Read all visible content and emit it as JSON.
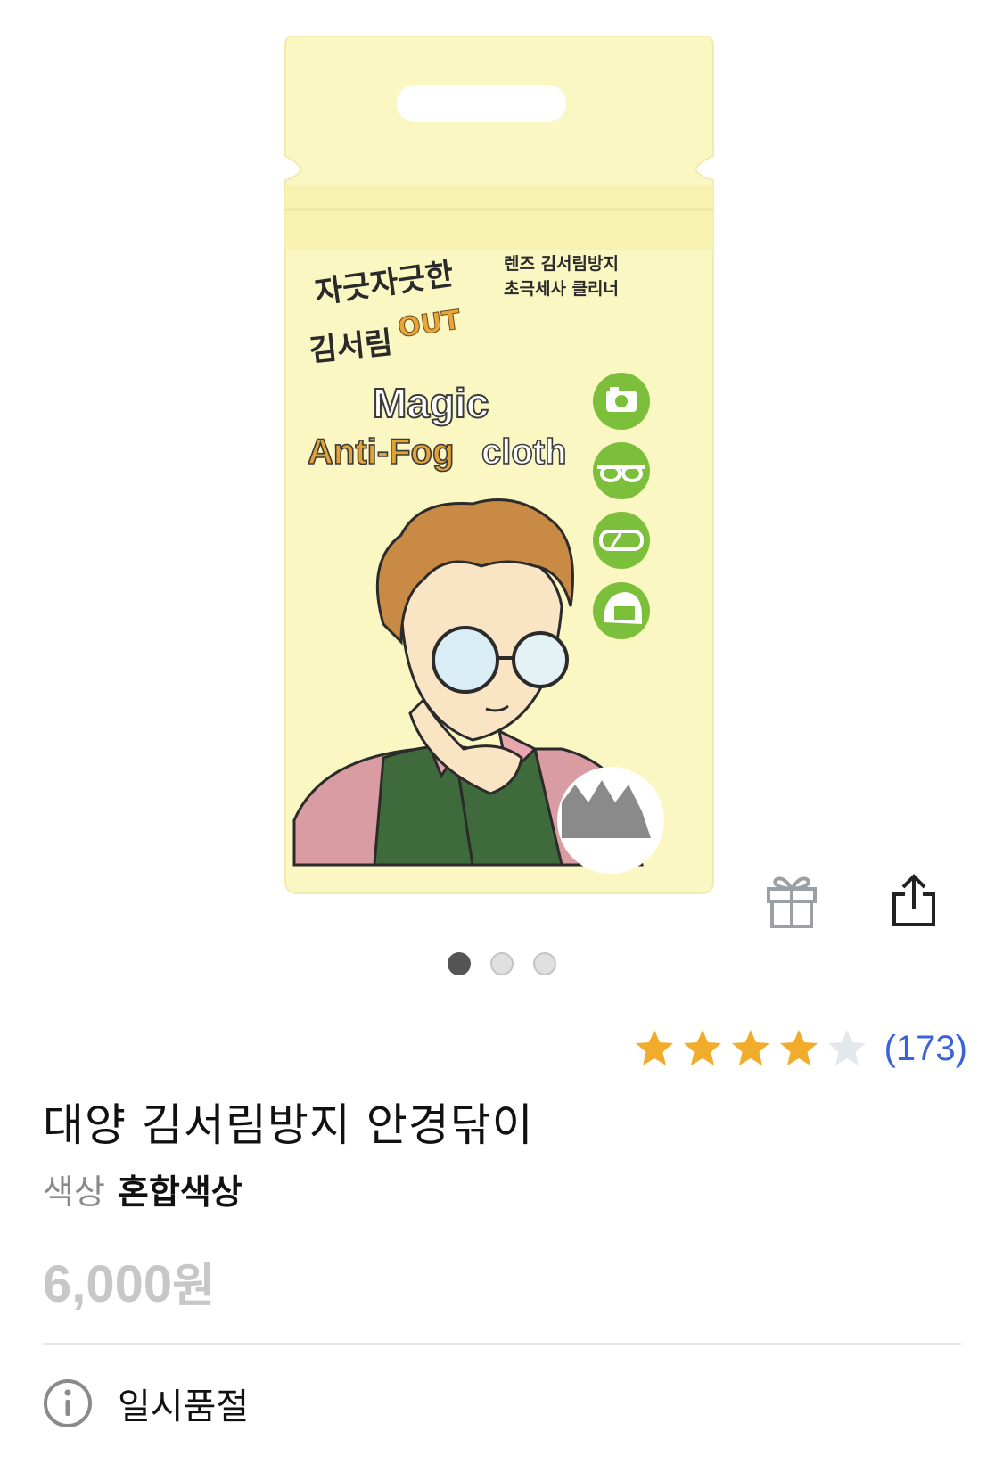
{
  "product_image": {
    "title_line1": "자긋자긋한",
    "title_line2": "김서림",
    "title_out": "OUT",
    "tagline_line1": "렌즈 김서림방지",
    "tagline_line2": "초극세사 클리너",
    "brand_magic": "Magic",
    "brand_antifog": "Anti-Fog",
    "brand_cloth": "cloth",
    "use_icons": [
      "camera-icon",
      "glasses-icon",
      "goggles-icon",
      "helmet-icon"
    ]
  },
  "gallery": {
    "page_count": 3,
    "active_index": 0
  },
  "rating": {
    "stars": 4,
    "max": 5,
    "count_label": "(173)"
  },
  "product": {
    "title": "대양 김서림방지 안경닦이",
    "option_label": "색상",
    "option_value": "혼합색상",
    "price_number": "6,000",
    "price_unit": "원"
  },
  "stock": {
    "status": "일시품절"
  },
  "colors": {
    "star_filled": "#f2ac2c",
    "star_empty": "#e4e7ec",
    "link": "#3a63d8",
    "pack_bg": "#fbf7c3",
    "icon_green": "#7cbf3a"
  }
}
